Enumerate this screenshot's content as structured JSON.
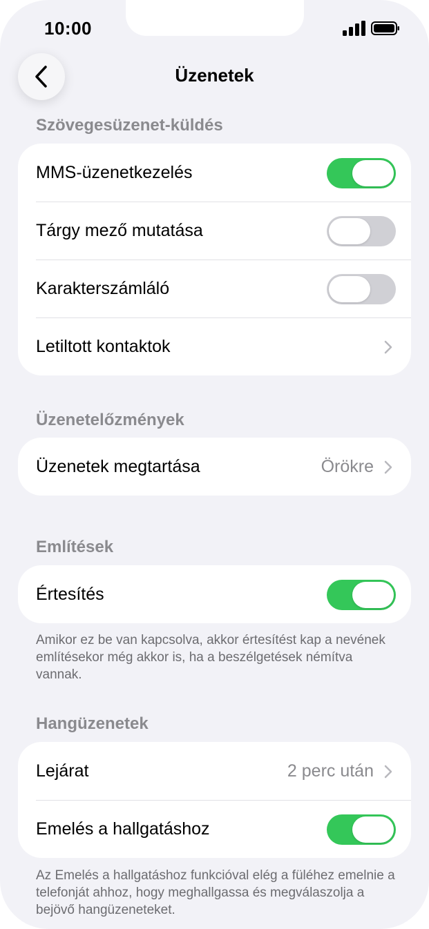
{
  "status_bar": {
    "time": "10:00"
  },
  "nav": {
    "title": "Üzenetek"
  },
  "sections": {
    "texting": {
      "header": "Szövegesüzenet-küldés",
      "mms": {
        "label": "MMS-üzenetkezelés",
        "on": true
      },
      "subject": {
        "label": "Tárgy mező mutatása",
        "on": false
      },
      "char_count": {
        "label": "Karakterszámláló",
        "on": false
      },
      "blocked": {
        "label": "Letiltott kontaktok"
      }
    },
    "history": {
      "header": "Üzenetelőzmények",
      "keep": {
        "label": "Üzenetek megtartása",
        "value": "Örökre"
      }
    },
    "mentions": {
      "header": "Említések",
      "notify": {
        "label": "Értesítés",
        "on": true
      },
      "footnote": "Amikor ez be van kapcsolva, akkor értesítést kap a nevének említésekor még akkor is, ha a beszélgetések némítva vannak."
    },
    "audio": {
      "header": "Hangüzenetek",
      "expire": {
        "label": "Lejárat",
        "value": "2 perc után"
      },
      "raise": {
        "label": "Emelés a hallgatáshoz",
        "on": true
      },
      "footnote": "Az Emelés a hallgatáshoz funkcióval elég a füléhez emelnie a telefonját ahhoz, hogy meghallgassa és megválaszolja a bejövő hangüzeneteket."
    }
  },
  "colors": {
    "toggle_on": "#34c759",
    "toggle_off": "#d0d0d5",
    "background": "#f2f2f7",
    "secondary_text": "#8a8a8e"
  }
}
